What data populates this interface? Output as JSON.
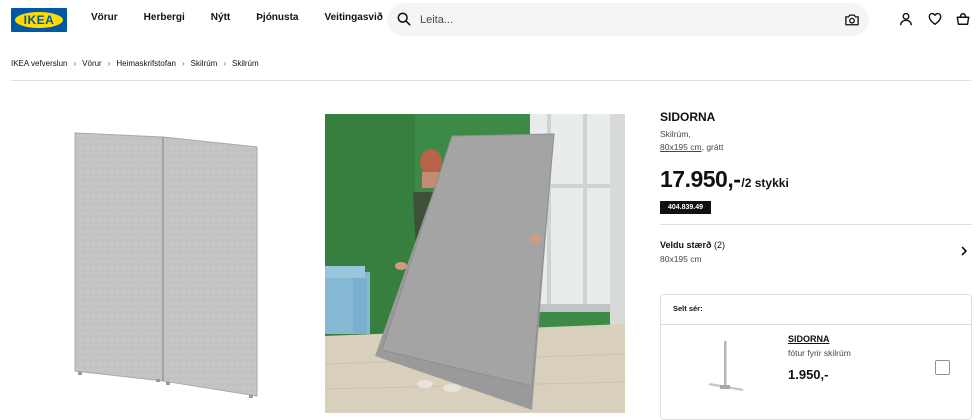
{
  "header": {
    "logo_text": "IKEA",
    "nav": [
      "Vörur",
      "Herbergi",
      "Nýtt",
      "Þjónusta",
      "Veitingasvið"
    ],
    "search_placeholder": "Leita..."
  },
  "breadcrumb": [
    "IKEA vefverslun",
    "Vörur",
    "Heimaskrifstofan",
    "Skilrúm",
    "Skilrúm"
  ],
  "product": {
    "name": "SIDORNA",
    "description": "Skilrúm,",
    "size_link": "80x195 cm",
    "color": ", grátt",
    "price": "17.950,-",
    "price_unit": "/2 stykki",
    "article_number": "404.839.49"
  },
  "size_select": {
    "label": "Veldu stærð",
    "count": "(2)",
    "value": "80x195 cm"
  },
  "sold_separately": {
    "title": "Selt sér:",
    "item_name": "SIDORNA",
    "item_desc": "fótur fyrir skilrúm",
    "item_price": "1.950,-"
  },
  "colors": {
    "brand_blue": "#0058a3",
    "brand_yellow": "#ffdb00",
    "panel_gray": "#bdbdbd",
    "wall_green": "#3f8a47"
  }
}
